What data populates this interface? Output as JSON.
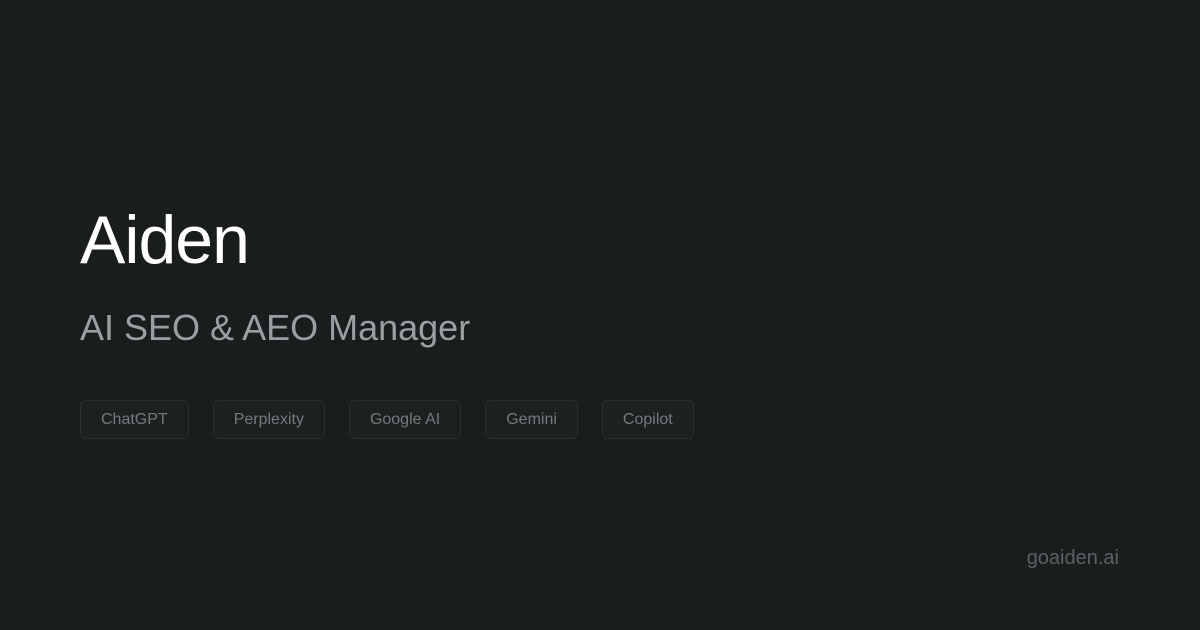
{
  "brand": {
    "title": "Aiden",
    "subtitle": "AI SEO & AEO Manager",
    "domain": "goaiden.ai"
  },
  "platforms": [
    {
      "label": "ChatGPT"
    },
    {
      "label": "Perplexity"
    },
    {
      "label": "Google AI"
    },
    {
      "label": "Gemini"
    },
    {
      "label": "Copilot"
    }
  ],
  "colors": {
    "background": "#1a1d1e",
    "title": "#ffffff",
    "subtitle": "#9c9fa1",
    "chip_text": "#767a7c",
    "chip_border": "#2b2f31",
    "domain_text": "#5d6163"
  }
}
